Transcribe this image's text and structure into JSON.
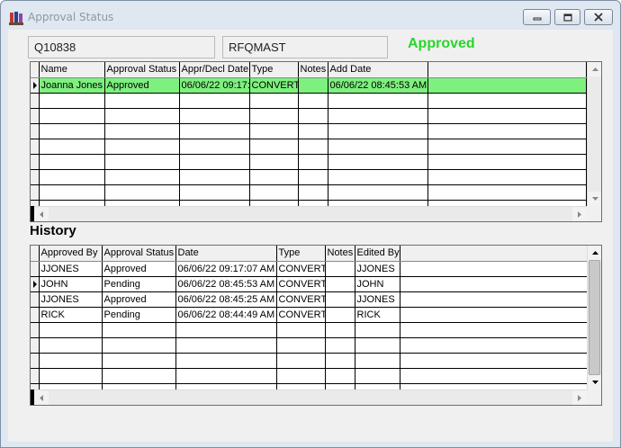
{
  "window": {
    "title": "Approval Status"
  },
  "header": {
    "quote_number": "Q10838",
    "table_name": "RFQMAST",
    "status": "Approved",
    "status_color": "#29d629"
  },
  "current_grid": {
    "columns": [
      "Name",
      "Approval Status",
      "Appr/Decl Date",
      "Type",
      "Notes",
      "Add Date"
    ],
    "rows": [
      [
        "Joanna Jones",
        "Approved",
        "06/06/22 09:17:",
        "CONVERT",
        "",
        "06/06/22 08:45:53 AM"
      ]
    ],
    "selected_row": 0,
    "selected_color": "#7ef07e"
  },
  "history": {
    "title": "History",
    "columns": [
      "Approved By",
      "Approval Status",
      "Date",
      "Type",
      "Notes",
      "Edited By"
    ],
    "rows": [
      [
        "JJONES",
        "Approved",
        "06/06/22 09:17:07 AM",
        "CONVERT",
        "",
        "JJONES"
      ],
      [
        "JOHN",
        "Pending",
        "06/06/22 08:45:53 AM",
        "CONVERT",
        "",
        "JOHN"
      ],
      [
        "JJONES",
        "Approved",
        "06/06/22 08:45:25 AM",
        "CONVERT",
        "",
        "JJONES"
      ],
      [
        "RICK",
        "Pending",
        "06/06/22 08:44:49 AM",
        "CONVERT",
        "",
        "RICK"
      ]
    ],
    "current_row": 1
  },
  "icons": {
    "app": "app-icon",
    "minimize": "minimize-icon",
    "maximize": "maximize-icon",
    "close": "close-icon"
  }
}
